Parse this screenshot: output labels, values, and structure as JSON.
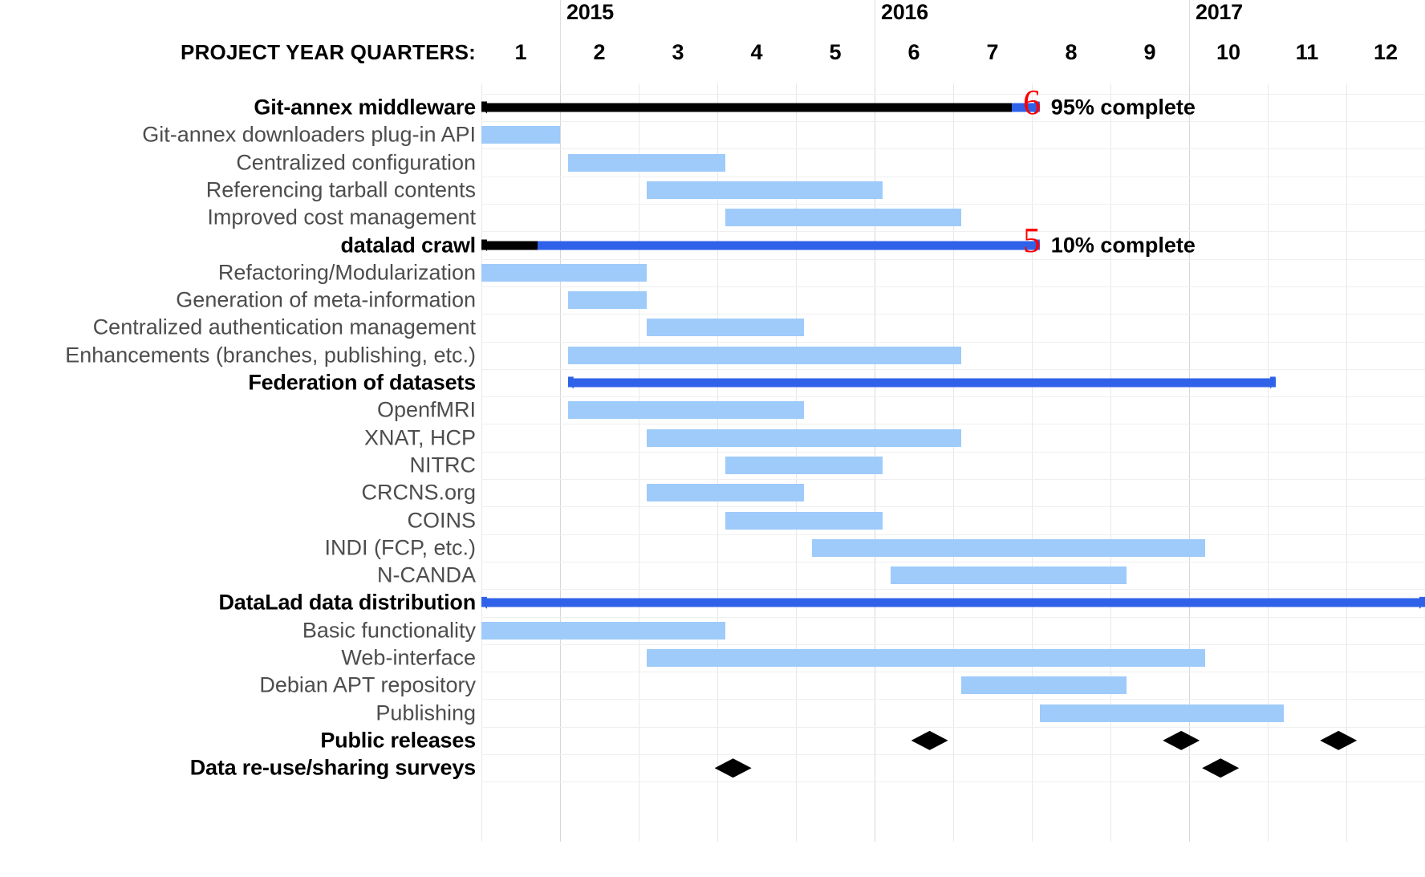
{
  "header": {
    "quarters_caption": "PROJECT YEAR QUARTERS:",
    "years": [
      {
        "label": "2015",
        "quarter_start": 2
      },
      {
        "label": "2016",
        "quarter_start": 6
      },
      {
        "label": "2017",
        "quarter_start": 10
      }
    ],
    "quarter_numbers": [
      "1",
      "2",
      "3",
      "4",
      "5",
      "6",
      "7",
      "8",
      "9",
      "10",
      "11",
      "12"
    ]
  },
  "colors": {
    "task_bar": "#9ecbfa",
    "summary_bar": "#2f62e8",
    "summary_complete": "#000000",
    "milestone": "#000000",
    "annotation": "#ff0000",
    "label_text": "#4d4d4d",
    "group_text": "#000000",
    "grid": "#e8e8e8"
  },
  "annotations": [
    {
      "text": "6",
      "quarter": 8.0,
      "row": 0
    },
    {
      "text": "5",
      "quarter": 8.0,
      "row": 5
    }
  ],
  "chart_data": {
    "type": "gantt",
    "title": "",
    "xlabel": "PROJECT YEAR QUARTERS:",
    "ylabel": "",
    "xlim": [
      1,
      13
    ],
    "grid": true,
    "legend": "none",
    "x_tick_labels": [
      "1",
      "2",
      "3",
      "4",
      "5",
      "6",
      "7",
      "8",
      "9",
      "10",
      "11",
      "12"
    ],
    "year_bands": [
      {
        "label": "2015",
        "start_quarter": 2,
        "end_quarter": 6
      },
      {
        "label": "2016",
        "start_quarter": 6,
        "end_quarter": 10
      },
      {
        "label": "2017",
        "start_quarter": 10,
        "end_quarter": 13
      }
    ],
    "tasks": [
      {
        "label": "Git-annex middleware",
        "type": "summary",
        "start": 1.0,
        "end": 8.1,
        "percent_complete": 95,
        "percent_label": "95% complete"
      },
      {
        "label": "Git-annex downloaders plug-in API",
        "type": "task",
        "start": 1.0,
        "end": 2.0
      },
      {
        "label": "Centralized configuration",
        "type": "task",
        "start": 2.1,
        "end": 4.1
      },
      {
        "label": "Referencing tarball contents",
        "type": "task",
        "start": 3.1,
        "end": 6.1
      },
      {
        "label": "Improved cost management",
        "type": "task",
        "start": 4.1,
        "end": 7.1
      },
      {
        "label": "datalad crawl",
        "type": "summary",
        "start": 1.0,
        "end": 8.1,
        "percent_complete": 10,
        "percent_label": "10% complete"
      },
      {
        "label": "Refactoring/Modularization",
        "type": "task",
        "start": 1.0,
        "end": 3.1
      },
      {
        "label": "Generation of meta-information",
        "type": "task",
        "start": 2.1,
        "end": 3.1
      },
      {
        "label": "Centralized authentication management",
        "type": "task",
        "start": 3.1,
        "end": 5.1
      },
      {
        "label": "Enhancements (branches, publishing, etc.)",
        "type": "task",
        "start": 2.1,
        "end": 7.1
      },
      {
        "label": "Federation of datasets",
        "type": "summary",
        "start": 2.1,
        "end": 11.1,
        "percent_complete": 0
      },
      {
        "label": "OpenfMRI",
        "type": "task",
        "start": 2.1,
        "end": 5.1
      },
      {
        "label": "XNAT, HCP",
        "type": "task",
        "start": 3.1,
        "end": 7.1
      },
      {
        "label": "NITRC",
        "type": "task",
        "start": 4.1,
        "end": 6.1
      },
      {
        "label": "CRCNS.org",
        "type": "task",
        "start": 3.1,
        "end": 5.1
      },
      {
        "label": "COINS",
        "type": "task",
        "start": 4.1,
        "end": 6.1
      },
      {
        "label": "INDI (FCP, etc.)",
        "type": "task",
        "start": 5.2,
        "end": 10.2
      },
      {
        "label": "N-CANDA",
        "type": "task",
        "start": 6.2,
        "end": 9.2
      },
      {
        "label": "DataLad data distribution",
        "type": "summary",
        "start": 1.0,
        "end": 13.0,
        "percent_complete": 0
      },
      {
        "label": "Basic functionality",
        "type": "task",
        "start": 1.0,
        "end": 4.1
      },
      {
        "label": "Web-interface",
        "type": "task",
        "start": 3.1,
        "end": 10.2
      },
      {
        "label": "Debian APT repository",
        "type": "task",
        "start": 7.1,
        "end": 9.2
      },
      {
        "label": "Publishing",
        "type": "task",
        "start": 8.1,
        "end": 11.2
      },
      {
        "label": "Public releases",
        "type": "milestones",
        "milestones": [
          6.7,
          9.9,
          11.9
        ]
      },
      {
        "label": "Data re-use/sharing surveys",
        "type": "milestones",
        "milestones": [
          4.2,
          10.4
        ]
      }
    ]
  }
}
